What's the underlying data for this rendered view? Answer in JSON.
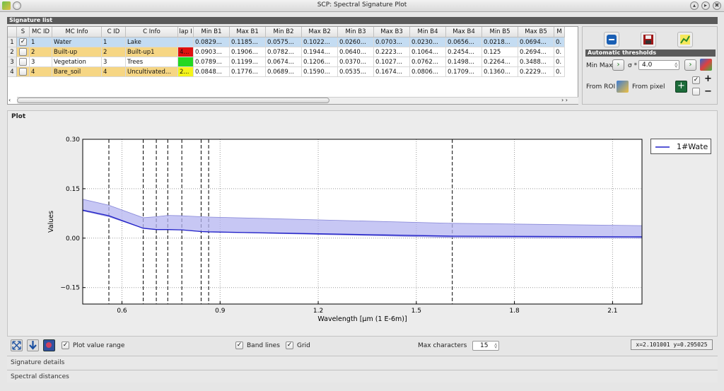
{
  "window": {
    "title": "SCP: Spectral Signature Plot",
    "min_glyph": "▴",
    "max_glyph": "▸",
    "close_glyph": "✖"
  },
  "signature_list": {
    "title": "Signature list",
    "columns": [
      "S",
      "MC ID",
      "MC Info",
      "C ID",
      "C Info",
      "lap I",
      "Min B1",
      "Max B1",
      "Min B2",
      "Max B2",
      "Min B3",
      "Max B3",
      "Min B4",
      "Max B4",
      "Min B5",
      "Max B5",
      "M"
    ],
    "rows": [
      {
        "num": "1",
        "checked": true,
        "mc_id": "1",
        "mc_info": "Water",
        "c_id": "1",
        "c_info": "Lake",
        "overlap": "",
        "overlap_color": "",
        "row_color": "#c4dcf2",
        "values": [
          "0.0829...",
          "0.1185...",
          "0.0575...",
          "0.1022...",
          "0.0260...",
          "0.0703...",
          "0.0230...",
          "0.0656...",
          "0.0218...",
          "0.0694...",
          "0."
        ]
      },
      {
        "num": "2",
        "checked": false,
        "mc_id": "2",
        "mc_info": "Built-up",
        "c_id": "2",
        "c_info": "Built-up1",
        "overlap": "4...",
        "overlap_color": "#e01010",
        "row_color": "#f6d684",
        "values": [
          "0.0903...",
          "0.1906...",
          "0.0782...",
          "0.1944...",
          "0.0640...",
          "0.2223...",
          "0.1064...",
          "0.2454...",
          "0.125",
          "0.2694...",
          "0."
        ]
      },
      {
        "num": "3",
        "checked": false,
        "mc_id": "3",
        "mc_info": "Vegetation",
        "c_id": "3",
        "c_info": "Trees",
        "overlap": "",
        "overlap_color": "#22d822",
        "row_color": "#ffffff",
        "values": [
          "0.0789...",
          "0.1199...",
          "0.0674...",
          "0.1206...",
          "0.0370...",
          "0.1027...",
          "0.0762...",
          "0.1498...",
          "0.2264...",
          "0.3488...",
          "0."
        ]
      },
      {
        "num": "4",
        "checked": false,
        "mc_id": "4",
        "mc_info": "Bare_soil",
        "c_id": "4",
        "c_info": "Uncultivated...",
        "overlap": "2...",
        "overlap_color": "#f4f41a",
        "row_color": "#f6d684",
        "values": [
          "0.0848...",
          "0.1776...",
          "0.0689...",
          "0.1590...",
          "0.0535...",
          "0.1674...",
          "0.0806...",
          "0.1709...",
          "0.1360...",
          "0.2229...",
          "0."
        ]
      }
    ]
  },
  "auto_thresholds": {
    "title": "Automatic thresholds",
    "min_max_label": "Min Max",
    "sigma_label": "σ *",
    "sigma_value": "4.0",
    "from_roi_label": "From ROI",
    "from_pixel_label": "From pixel",
    "plus": "+",
    "minus": "−"
  },
  "plot": {
    "title": "Plot",
    "toolbar": {
      "plot_value_range": "Plot value range",
      "band_lines": "Band lines",
      "grid": "Grid",
      "max_characters_label": "Max characters",
      "max_characters_value": "15",
      "coordinates": "x=2.101001 y=0.295025"
    },
    "legend": [
      "1#Wate"
    ]
  },
  "chart_data": {
    "type": "line",
    "xlabel": "Wavelength [µm (1 E-6m)]",
    "ylabel": "Values",
    "xlim": [
      0.48,
      2.19
    ],
    "ylim": [
      -0.2,
      0.3
    ],
    "xticks": [
      0.6,
      0.9,
      1.2,
      1.5,
      1.8,
      2.1
    ],
    "xtick_labels": [
      "0.6",
      "0.9",
      "1.2",
      "1.5",
      "1.8",
      "2.1"
    ],
    "yticks": [
      0.3,
      0.15,
      0.0,
      -0.15
    ],
    "ytick_labels": [
      "0.30",
      "0.15",
      "0.00",
      "−0.15"
    ],
    "grid": true,
    "legend_position": "outside-top-right",
    "band_lines": [
      0.56,
      0.665,
      0.705,
      0.74,
      0.783,
      0.842,
      0.865,
      1.61
    ],
    "series": [
      {
        "name": "1#Wate",
        "color": "#2020c8",
        "fill_color": "#b4b4f0",
        "x": [
          0.48,
          0.56,
          0.665,
          0.705,
          0.74,
          0.783,
          0.842,
          0.865,
          1.61,
          2.19
        ],
        "mean": [
          0.085,
          0.068,
          0.03,
          0.026,
          0.026,
          0.025,
          0.02,
          0.019,
          0.006,
          0.004
        ],
        "min": [
          0.083,
          0.065,
          0.03,
          0.026,
          0.026,
          0.025,
          0.02,
          0.019,
          0.002,
          0.0
        ],
        "max": [
          0.118,
          0.1,
          0.062,
          0.065,
          0.069,
          0.068,
          0.065,
          0.064,
          0.045,
          0.038
        ]
      }
    ]
  },
  "panels": {
    "signature_details": "Signature details",
    "spectral_distances": "Spectral distances"
  }
}
